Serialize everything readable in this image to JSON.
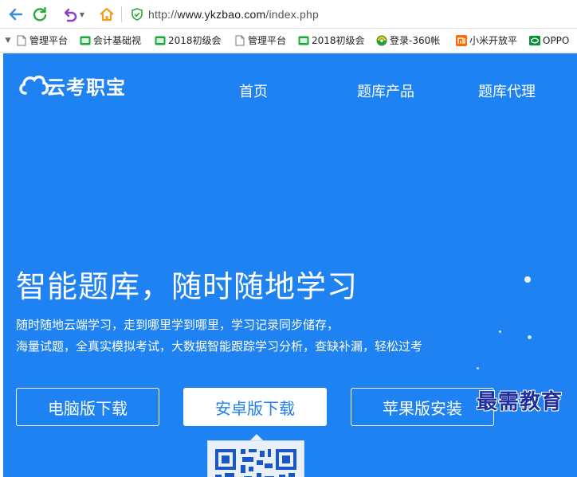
{
  "browser": {
    "url_prefix": "http://",
    "url_host": "www.ykzbao.com",
    "url_path": "/index.php"
  },
  "bookmarks": [
    {
      "label": "管理平台",
      "icon": "page-icon"
    },
    {
      "label": "会计基础视",
      "icon": "green-site-icon"
    },
    {
      "label": "2018初级会",
      "icon": "green-site-icon"
    },
    {
      "label": "管理平台",
      "icon": "page-icon"
    },
    {
      "label": "2018初级会",
      "icon": "green-site-icon"
    },
    {
      "label": "登录-360帐",
      "icon": "360-icon"
    },
    {
      "label": "小米开放平",
      "icon": "mi-icon"
    },
    {
      "label": "OPPO",
      "icon": "oppo-icon"
    }
  ],
  "site": {
    "logo_text": "云考职宝",
    "nav": [
      "首页",
      "题库产品",
      "题库代理"
    ],
    "hero_title": "智能题库，随时随地学习",
    "hero_line1": "随时随地云端学习，走到哪里学到哪里，学习记录同步储存，",
    "hero_line2": "海量试题，全真实模拟考试，大数据智能跟踪学习分析，查缺补漏，轻松过考",
    "buttons": [
      "电脑版下载",
      "安卓版下载",
      "苹果版安装"
    ],
    "active_button_index": 1
  },
  "watermark": "最需教育",
  "colors": {
    "brand_blue": "#1e82f2",
    "back_arrow": "#3a8be0",
    "refresh": "#2faa3c",
    "undo": "#8a3fc7",
    "home": "#f0a020"
  }
}
